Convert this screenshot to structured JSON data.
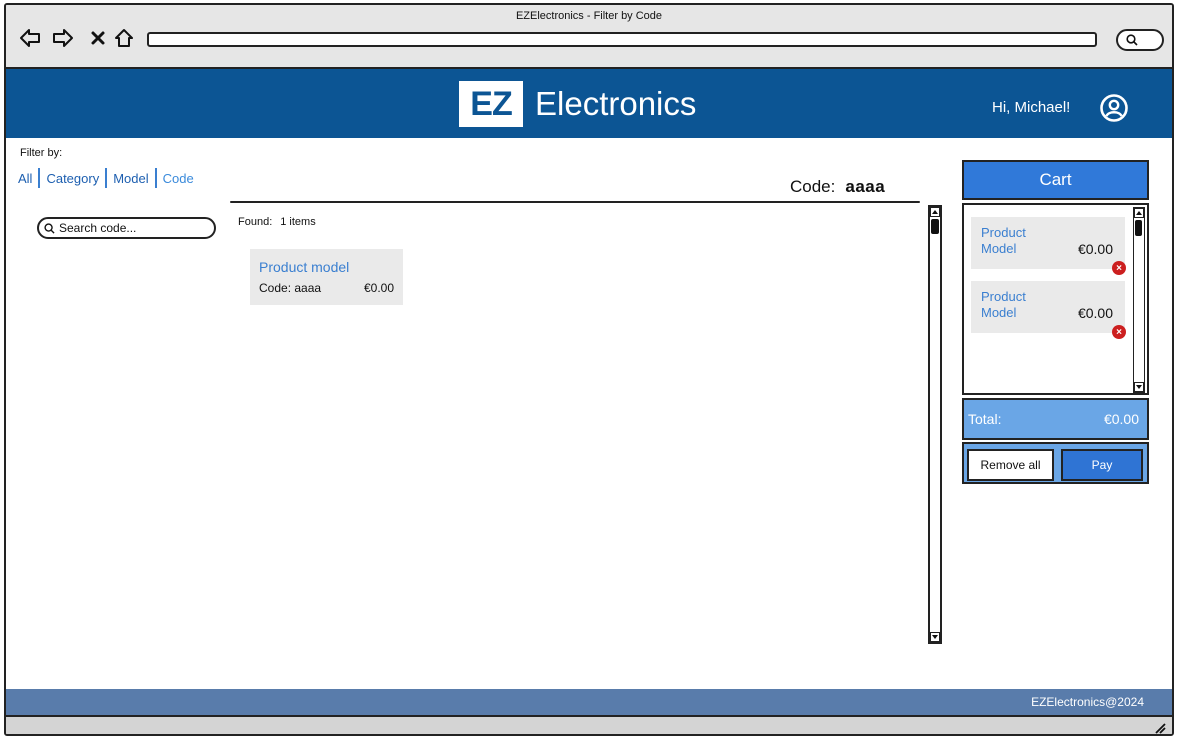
{
  "window": {
    "title": "EZElectronics - Filter by Code"
  },
  "header": {
    "logo_mark": "EZ",
    "logo_text": "Electronics",
    "greeting": "Hi, Michael!"
  },
  "filter": {
    "label": "Filter by:",
    "options": [
      "All",
      "Category",
      "Model",
      "Code"
    ],
    "active": "Code"
  },
  "search": {
    "placeholder": "Search code..."
  },
  "code_filter": {
    "label": "Code:",
    "value": "aaaa"
  },
  "results": {
    "found_label": "Found:",
    "count_label": "1 items",
    "items": [
      {
        "model": "Product model",
        "code_label": "Code: aaaa",
        "price": "€0.00"
      }
    ]
  },
  "cart": {
    "title": "Cart",
    "items": [
      {
        "model": "Product Model",
        "price": "€0.00"
      },
      {
        "model": "Product Model",
        "price": "€0.00"
      }
    ],
    "total_label": "Total:",
    "total_value": "€0.00",
    "remove_all_label": "Remove all",
    "pay_label": "Pay"
  },
  "footer": {
    "text": "EZElectronics@2024"
  },
  "colors": {
    "header": "#0c5594",
    "cart_header": "#3079d9",
    "cart_panel": "#6aa6e6",
    "footer": "#597cab",
    "link": "#1d5fb0",
    "remove": "#cc1f1f"
  }
}
